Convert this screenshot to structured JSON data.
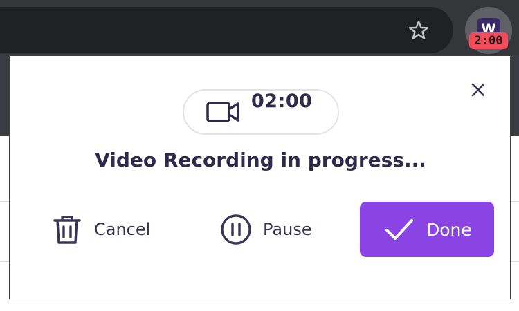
{
  "browser": {
    "extension_logo": "W",
    "extension_badge": "2:00",
    "icons": [
      "star-icon"
    ]
  },
  "popup": {
    "timer": "02:00",
    "status": "Video Recording in progress...",
    "actions": {
      "cancel_label": "Cancel",
      "pause_label": "Pause",
      "done_label": "Done"
    },
    "icons": [
      "close-icon",
      "video-camera-icon",
      "trash-icon",
      "pause-icon",
      "checkmark-icon"
    ]
  },
  "colors": {
    "accent": "#8a44e4",
    "text": "#2f2a4a",
    "badge": "#f24b5c",
    "chrome": "#35363a"
  }
}
